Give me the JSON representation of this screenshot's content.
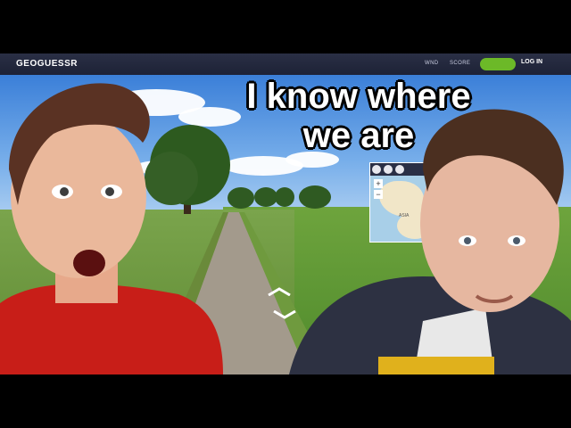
{
  "game": {
    "logo_text": "GEOGUESSR",
    "menu": [
      "WND",
      "SCORE"
    ],
    "login_label": "LOG IN",
    "brand_colors": {
      "topbar": "#2a2f45",
      "accent_green": "#6cb928",
      "logo_pin": "#e8453c"
    }
  },
  "caption": {
    "line1": "I know where",
    "line2": "we are"
  },
  "minimap": {
    "label": "ASIA",
    "zoom_in": "+",
    "zoom_out": "−"
  },
  "icons": [
    "geoguessr-logo-icon",
    "map-pin-icon",
    "nav-arrow-up-icon",
    "nav-arrow-down-icon",
    "map-tool-icon"
  ]
}
